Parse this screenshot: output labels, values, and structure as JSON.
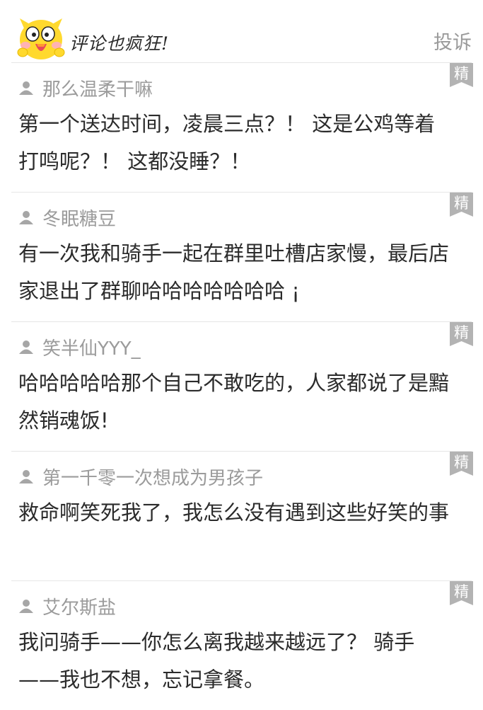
{
  "header": {
    "title": "评论也疯狂!",
    "report_label": "投诉",
    "mascot": "yellow-chick-mascot"
  },
  "badge_label": "精",
  "colors": {
    "badge": "#b3b3b3",
    "divider": "#e6e6e6",
    "author": "#9b9b9b",
    "text": "#2b2b2b"
  },
  "comments": [
    {
      "author": "那么温柔干嘛",
      "text": "第一个送达时间，凌晨三点？！ 这是公鸡等着打鸣呢？！ 这都没睡？！"
    },
    {
      "author": "冬眠糖豆",
      "text": "有一次我和骑手一起在群里吐槽店家慢，最后店家退出了群聊哈哈哈哈哈哈哈 ¡"
    },
    {
      "author": "笑半仙YYY_",
      "text": "哈哈哈哈哈那个自己不敢吃的，人家都说了是黯然销魂饭!"
    },
    {
      "author": "第一千零一次想成为男孩子",
      "text": "救命啊笑死我了，我怎么没有遇到这些好笑的事"
    },
    {
      "author": "艾尔斯盐",
      "text": "我问骑手——你怎么离我越来越远了？ 骑手——我也不想，忘记拿餐。"
    }
  ]
}
